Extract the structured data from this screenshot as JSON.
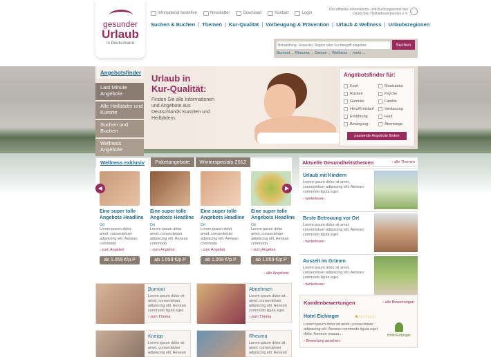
{
  "brand": {
    "line1": "gesunder",
    "line2": "Urlaub",
    "line3": "in Deutschland"
  },
  "toplinks": [
    {
      "label": "Infomaterial bestellen",
      "icon": "document-icon"
    },
    {
      "label": "Newsletter",
      "icon": "envelope-icon"
    },
    {
      "label": "Download",
      "icon": "download-icon"
    },
    {
      "label": "Kontakt",
      "icon": "contact-icon"
    },
    {
      "label": "Login",
      "icon": "login-icon"
    }
  ],
  "tagline": "Das offizielle Informations- und Buchungsportal des Deutschen Heilbäderverbandes e.V.",
  "nav": [
    "Suchen & Buchen",
    "Themen",
    "Kur-Qualität",
    "Vorbeugung & Prävention",
    "Urlaub & Wellness",
    "Urlaubsregionen"
  ],
  "search": {
    "placeholder": "Behandlung, Reiseziel, Region oder Suchbegriff eingeben",
    "button": "Suchen",
    "tags": [
      "Burnout",
      "Rheuma",
      "Ostsee",
      "Wellness",
      "mehr ..."
    ]
  },
  "hero": {
    "finder_tab": "Angebotsfinder",
    "nav": [
      "Last Minute Angebote",
      "Alle Heilbäder und Kurorte",
      "Suchen und Buchen",
      "Wellness Angebote"
    ],
    "title_line1": "Urlaub in",
    "title_line2": "Kur-Qualität:",
    "text": "Finden Sie alle Informationen und Angebote aus Deutschlands Kurorten und Heilbädern."
  },
  "finder": {
    "title": "Angebotsfinder für:",
    "options": [
      "Kopf",
      "Muskulatur",
      "Rücken",
      "Psyche",
      "Gelenke",
      "Familie",
      "Herz/Kreislauf",
      "Verdauung",
      "Ernährung",
      "Haut",
      "Bewegung",
      "Atemwege"
    ],
    "button": "passende Angebote finden"
  },
  "offers": {
    "tabs": [
      "Wellness exklusiv",
      "Paketangebote",
      "Winterspecials 2012"
    ],
    "cards": [
      {
        "title": "Eine super tolle Angebots Headline",
        "place": "Ort",
        "desc": "Lorem ipsum dolor amet, consectetuer adipiscing elit. Aenean commodo",
        "link": "› zum Angebot",
        "price": "ab 1.059 €/p.P"
      },
      {
        "title": "Eine super tolle Angebots Headline",
        "place": "Ort",
        "desc": "Lorem ipsum dolor amet, consectetuer adipiscing elit. Aenean commodo",
        "link": "› zum Angebot",
        "price": "ab 1.059 €/p.P"
      },
      {
        "title": "Eine super tolle Angebots Headline",
        "place": "Ort",
        "desc": "Lorem ipsum dolor amet, consectetuer adipiscing elit. Aenean commodo",
        "link": "› zum Angebot",
        "price": "ab 1.059 €/p.P"
      },
      {
        "title": "Eine super tolle Angebots Headline",
        "place": "Ort",
        "desc": "Lorem ipsum dolor amet, consectetuer adipiscing elit. Aenean commodo",
        "link": "› zum Angebot",
        "price": "ab 1.059 €/p.P"
      }
    ],
    "all_link": "› alle Angebote"
  },
  "topics": [
    {
      "title": "Burnout",
      "desc": "Lorem ipsum dolor sit amet, consectetuer adipiscing elit. Aenean commodo ligula eget.",
      "link": "› zum Thema"
    },
    {
      "title": "Abnehmen",
      "desc": "Lorem ipsum dolor sit amet, consectetuer adipiscing elit. Aenean commodo ligula eget.",
      "link": "› zum Thema"
    },
    {
      "title": "Kneipp",
      "desc": "Lorem ipsum dolor sit amet, consectetuer adipiscing elit. Aenean",
      "link": ""
    },
    {
      "title": "Rheuma",
      "desc": "Lorem ipsum dolor sit amet, consectetuer adipiscing elit. Aenean",
      "link": ""
    }
  ],
  "health": {
    "title": "Aktuelle Gesundheitsthemen",
    "all_link": "› alle Themen",
    "items": [
      {
        "title": "Urlaub mit Kindern",
        "desc": "Lorem ipsum dolor sit amet, consectetuer adipiscing elit. Aenean commodo ligula eget.",
        "link": "› weiterlesen"
      },
      {
        "title": "Beste Betreuung vor Ort",
        "desc": "Lorem ipsum dolor sit amet, consectetuer adipiscing elit. Aenean commodo ligula eget.",
        "link": "› weiterlesen"
      },
      {
        "title": "Auszeit im Grünen",
        "desc": "Lorem ipsum dolor sit amet, consectetuer adipiscing elit. Aenean commodo ligula eget.",
        "link": "› weiterlesen"
      }
    ]
  },
  "reviews": {
    "title": "Kundenbewertungen",
    "all_link": "› alle Bewertungen",
    "hotel": "Hotel Eichinger",
    "stars": "★☆☆☆☆",
    "desc": "Lorem ipsum dolor sit amet, consectetuer adipiscing elit. Aenean commodo ligula eget dolor. Aenean massa...",
    "link": "› Bewertung ansehen",
    "logo_text": "Hotel Eichinger"
  },
  "colors": {
    "accent": "#9b2a5c",
    "link": "#1f6c8f",
    "nav_bg": "#8a7b70"
  }
}
